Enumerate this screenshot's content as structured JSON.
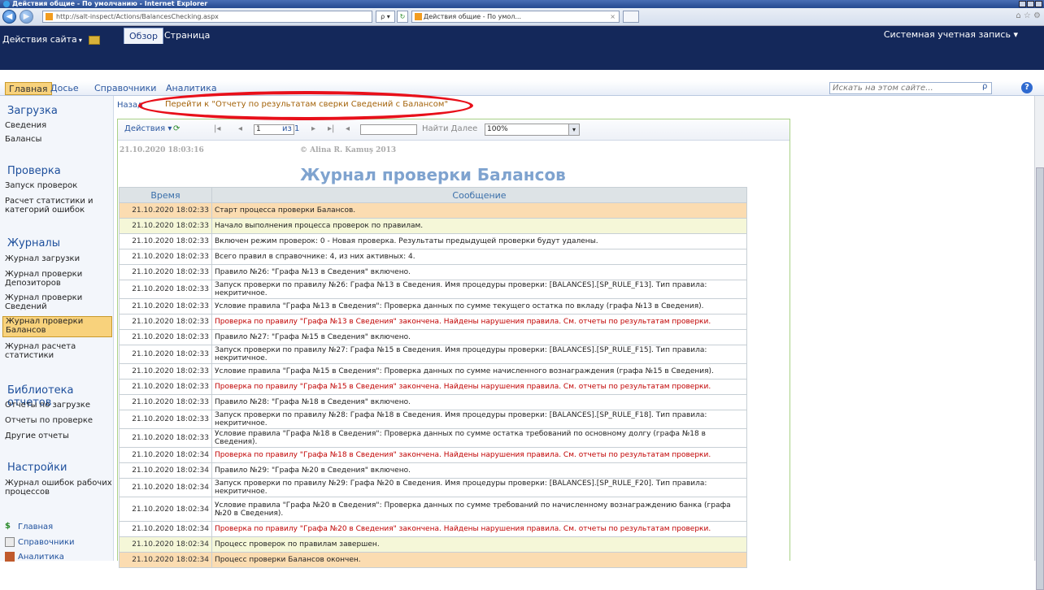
{
  "browser": {
    "window_title": "Действия общие - По умолчанию - Internet Explorer",
    "url": "http://salt-inspect/Actions/BalancesChecking.aspx",
    "tab_title": "Действия общие - По умол...",
    "search_label": "ρ ▾",
    "refresh_label": "↻"
  },
  "ribbon": {
    "site_actions": "Действия сайта",
    "tabs": [
      "Обзор",
      "Страница"
    ],
    "account": "Системная учетная запись"
  },
  "topnav": {
    "items": [
      "Главная",
      "Досье",
      "Справочники",
      "Аналитика"
    ],
    "search_placeholder": "Искать на этом сайте..."
  },
  "leftnav": {
    "sections": [
      {
        "title": "Загрузка",
        "items": [
          "Сведения",
          "Балансы"
        ]
      },
      {
        "title": "Проверка",
        "items": [
          "Запуск проверок",
          "Расчет статистики и категорий ошибок"
        ]
      },
      {
        "title": "Журналы",
        "items": [
          "Журнал загрузки",
          "Журнал проверки Депозиторов",
          "Журнал проверки Сведений",
          "Журнал проверки Балансов",
          "Журнал расчета статистики"
        ]
      },
      {
        "title": "Библиотека отчетов",
        "items": [
          "Отчеты по загрузке",
          "Отчеты по проверке",
          "Другие отчеты"
        ]
      },
      {
        "title": "Настройки",
        "items": [
          "Журнал ошибок рабочих процессов"
        ]
      }
    ],
    "bottom": [
      "Главная",
      "Справочники",
      "Аналитика"
    ]
  },
  "main": {
    "back_link": "Назад",
    "goto_link": "Перейти к \"Отчету по результатам сверки Сведений с Балансом\""
  },
  "report": {
    "toolbar": {
      "actions": "Действия",
      "page": "1",
      "of": "из 1",
      "find_next": "Найти Далее",
      "zoom": "100%"
    },
    "timestamp": "21.10.2020 18:03:16",
    "copyright": "© Alina R. Kamuş 2013",
    "title": "Журнал проверки Балансов",
    "columns": [
      "Время",
      "Сообщение"
    ],
    "rows": [
      {
        "time": "21.10.2020 18:02:33",
        "msg": "Старт процесса проверки Балансов.",
        "type": "start"
      },
      {
        "time": "21.10.2020 18:02:33",
        "msg": "Начало выполнения процесса проверок по правилам.",
        "type": "rule"
      },
      {
        "time": "21.10.2020 18:02:33",
        "msg": "Включен режим проверок: 0 - Новая проверка. Результаты предыдущей проверки будут удалены.",
        "type": "norm"
      },
      {
        "time": "21.10.2020 18:02:33",
        "msg": "Всего правил в справочнике: 4, из них активных: 4.",
        "type": "norm"
      },
      {
        "time": "21.10.2020 18:02:33",
        "msg": "Правило №26: \"Графа №13 в Сведения\" включено.",
        "type": "norm"
      },
      {
        "time": "21.10.2020 18:02:33",
        "msg": "Запуск проверки по правилу №26: Графа №13 в Сведения. Имя процедуры проверки: [BALANCES].[SP_RULE_F13]. Тип правила: некритичное.",
        "type": "norm"
      },
      {
        "time": "21.10.2020 18:02:33",
        "msg": "Условие правила \"Графа №13 в Сведения\": Проверка данных по сумме текущего остатка по вкладу (графа №13 в Сведения).",
        "type": "norm"
      },
      {
        "time": "21.10.2020 18:02:33",
        "msg": "Проверка по правилу \"Графа №13 в Сведения\" закончена. Найдены нарушения правила. См. отчеты по результатам проверки.",
        "type": "err"
      },
      {
        "time": "21.10.2020 18:02:33",
        "msg": "Правило №27: \"Графа №15 в Сведения\" включено.",
        "type": "norm"
      },
      {
        "time": "21.10.2020 18:02:33",
        "msg": "Запуск проверки по правилу №27: Графа №15 в Сведения. Имя процедуры проверки: [BALANCES].[SP_RULE_F15]. Тип правила: некритичное.",
        "type": "norm"
      },
      {
        "time": "21.10.2020 18:02:33",
        "msg": "Условие правила \"Графа №15 в Сведения\": Проверка данных по сумме начисленного вознаграждения (графа №15 в Сведения).",
        "type": "norm"
      },
      {
        "time": "21.10.2020 18:02:33",
        "msg": "Проверка по правилу \"Графа №15 в Сведения\" закончена. Найдены нарушения правила. См. отчеты по результатам проверки.",
        "type": "err"
      },
      {
        "time": "21.10.2020 18:02:33",
        "msg": "Правило №28: \"Графа №18 в Сведения\" включено.",
        "type": "norm"
      },
      {
        "time": "21.10.2020 18:02:33",
        "msg": "Запуск проверки по правилу №28: Графа №18 в Сведения. Имя процедуры проверки: [BALANCES].[SP_RULE_F18]. Тип правила: некритичное.",
        "type": "norm"
      },
      {
        "time": "21.10.2020 18:02:33",
        "msg": "Условие правила \"Графа №18 в Сведения\": Проверка данных по сумме остатка требований по основному долгу (графа №18 в Сведения).",
        "type": "norm"
      },
      {
        "time": "21.10.2020 18:02:34",
        "msg": "Проверка по правилу \"Графа №18 в Сведения\" закончена. Найдены нарушения правила. См. отчеты по результатам проверки.",
        "type": "err"
      },
      {
        "time": "21.10.2020 18:02:34",
        "msg": "Правило №29: \"Графа №20 в Сведения\" включено.",
        "type": "norm"
      },
      {
        "time": "21.10.2020 18:02:34",
        "msg": "Запуск проверки по правилу №29: Графа №20 в Сведения. Имя процедуры проверки: [BALANCES].[SP_RULE_F20]. Тип правила: некритичное.",
        "type": "norm"
      },
      {
        "time": "21.10.2020 18:02:34",
        "msg": "Условие правила \"Графа №20 в Сведения\": Проверка данных по сумме требований по начисленному вознаграждению банка (графа №20 в Сведения).",
        "type": "norm"
      },
      {
        "time": "21.10.2020 18:02:34",
        "msg": "Проверка по правилу \"Графа №20 в Сведения\" закончена. Найдены нарушения правила. См. отчеты по результатам проверки.",
        "type": "err"
      },
      {
        "time": "21.10.2020 18:02:34",
        "msg": "Процесс проверок по правилам завершен.",
        "type": "rule"
      },
      {
        "time": "21.10.2020 18:02:34",
        "msg": "Процесс проверки Балансов окончен.",
        "type": "start"
      }
    ]
  },
  "colors": {
    "ribbon_bg": "#14285a",
    "selected_bg": "#f8d27c",
    "error_text": "#c00000",
    "highlight_oval": "#e8101a"
  }
}
